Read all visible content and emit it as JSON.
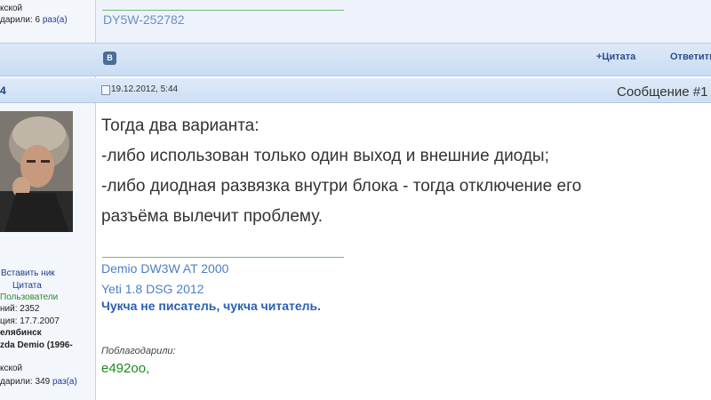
{
  "prev_post": {
    "left_line1": "кской",
    "left_thanks_prefix": "дарили: 6",
    "left_thanks_link": "раз(а)",
    "signature": "DY5W-252782"
  },
  "action_bar": {
    "share_icon": "vk-icon",
    "quote_label": "+Цитата",
    "reply_label": "Ответить"
  },
  "post": {
    "user_num": "4",
    "date": "19.12.2012, 5:44",
    "message_label": "Сообщение #1",
    "text_lines": [
      "Тогда два варианта:",
      "-либо использован только один выход и внешние диоды;",
      "-либо диодная развязка внутри блока - тогда отключение его",
      "разъёма вылечит проблему."
    ],
    "signature": {
      "line1": "Demio DW3W AT 2000",
      "line2": "Yeti 1.8 DSG 2012",
      "motto": "Чукча не писатель, чукча читатель."
    },
    "thanks_label": "Поблагодарили:",
    "thanks_user": "e492oo",
    "thanks_suffix": ","
  },
  "user_panel": {
    "insert_nick": "Вставить ник",
    "quote": "Цитата",
    "group": "Пользователи",
    "messages": "ний: 2352",
    "registered": "ция: 17.7.2007",
    "city": "елябинск",
    "car": "zda Demio (1996-",
    "line_extra": "кской",
    "thanks_prefix": "дарили: 349",
    "thanks_link": "раз(а)"
  },
  "colors": {
    "link": "#1e3d8f",
    "group_green": "#2e8b2e",
    "signature_blue": "#4a7fc8",
    "thanks_green": "#1a8a1a"
  }
}
